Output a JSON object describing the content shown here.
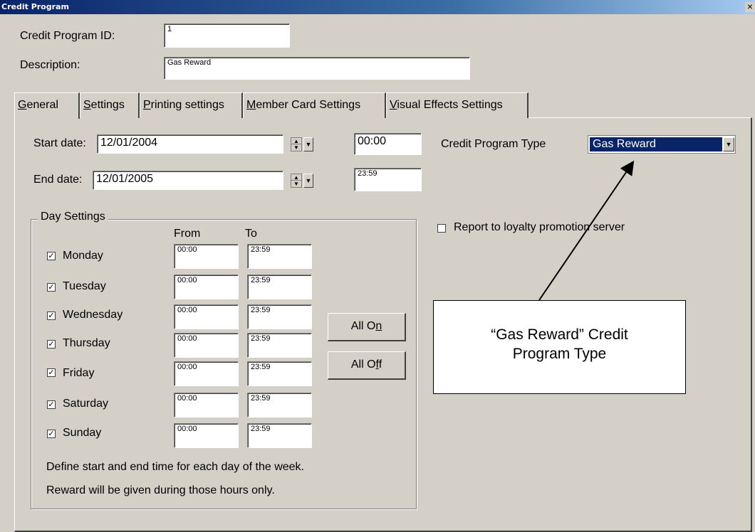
{
  "window": {
    "title": "Credit Program",
    "close": "×"
  },
  "header": {
    "program_id_label": "Credit Program ID:",
    "program_id_value": "1",
    "description_label": "Description:",
    "description_value": "Gas Reward"
  },
  "tabs": [
    {
      "label": "General",
      "mnemonic": "G",
      "rest": "eneral"
    },
    {
      "label": "Settings",
      "mnemonic": "S",
      "rest": "ettings"
    },
    {
      "label": "Printing settings",
      "mnemonic": "P",
      "rest": "rinting settings"
    },
    {
      "label": "Member Card Settings",
      "mnemonic": "M",
      "rest": "ember Card Settings"
    },
    {
      "label": "Visual Effects Settings",
      "mnemonic": "V",
      "rest": "isual Effects Settings"
    }
  ],
  "general": {
    "start_date_label": "Start date:",
    "start_date_value": "12/01/2004",
    "start_time_value": "00:00",
    "end_date_label": "End date:",
    "end_date_value": "12/01/2005",
    "end_time_value": "23:59",
    "program_type_label": "Credit Program Type",
    "program_type_value": "Gas Reward",
    "report_label": "Report to loyalty promotion server",
    "report_checked": false
  },
  "day_settings": {
    "title": "Day Settings",
    "from_header": "From",
    "to_header": "To",
    "days": [
      {
        "name": "Monday",
        "checked": true,
        "from": "00:00",
        "to": "23:59"
      },
      {
        "name": "Tuesday",
        "checked": true,
        "from": "00:00",
        "to": "23:59"
      },
      {
        "name": "Wednesday",
        "checked": true,
        "from": "00:00",
        "to": "23:59"
      },
      {
        "name": "Thursday",
        "checked": true,
        "from": "00:00",
        "to": "23:59"
      },
      {
        "name": "Friday",
        "checked": true,
        "from": "00:00",
        "to": "23:59"
      },
      {
        "name": "Saturday",
        "checked": true,
        "from": "00:00",
        "to": "23:59"
      },
      {
        "name": "Sunday",
        "checked": true,
        "from": "00:00",
        "to": "23:59"
      }
    ],
    "all_on": {
      "pre": "All O",
      "mnemonic": "n"
    },
    "all_off": {
      "pre": "All O",
      "mnemonic": "f",
      "post": "f"
    },
    "note_line1": "Define start and end time for each day of the week.",
    "note_line2": "Reward will be given during those hours only."
  },
  "annotation": {
    "line1": "“Gas Reward” Credit",
    "line2": "Program Type"
  },
  "icons": {
    "check": "✓",
    "spin_up": "▲",
    "spin_down": "▼",
    "dropdown": "▼"
  }
}
